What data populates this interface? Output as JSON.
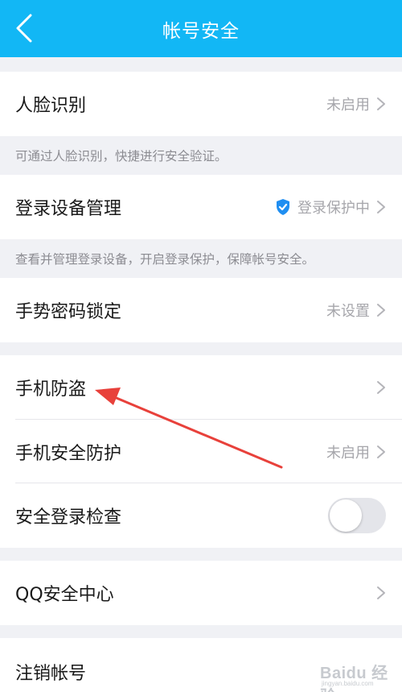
{
  "header": {
    "title": "帐号安全",
    "bg_color": "#12b7f5"
  },
  "rows": {
    "face_recognition": {
      "label": "人脸识别",
      "status": "未启用"
    },
    "device_management": {
      "label": "登录设备管理",
      "status": "登录保护中"
    },
    "gesture_lock": {
      "label": "手势密码锁定",
      "status": "未设置"
    },
    "anti_theft": {
      "label": "手机防盗"
    },
    "phone_protection": {
      "label": "手机安全防护",
      "status": "未启用"
    },
    "login_check": {
      "label": "安全登录检查",
      "toggle_on": false
    },
    "qq_security_center": {
      "label": "QQ安全中心"
    },
    "cancel_account": {
      "label": "注销帐号"
    }
  },
  "hints": {
    "face_recognition": "可通过人脸识别，快捷进行安全验证。",
    "device_management": "查看并管理登录设备，开启登录保护，保障帐号安全。"
  },
  "watermark": {
    "text": "Baidu 经验",
    "sub": "jingyan.baidu.com"
  },
  "colors": {
    "accent": "#12b7f5",
    "shield": "#1f8ef1",
    "annotation_arrow": "#e8413b"
  }
}
